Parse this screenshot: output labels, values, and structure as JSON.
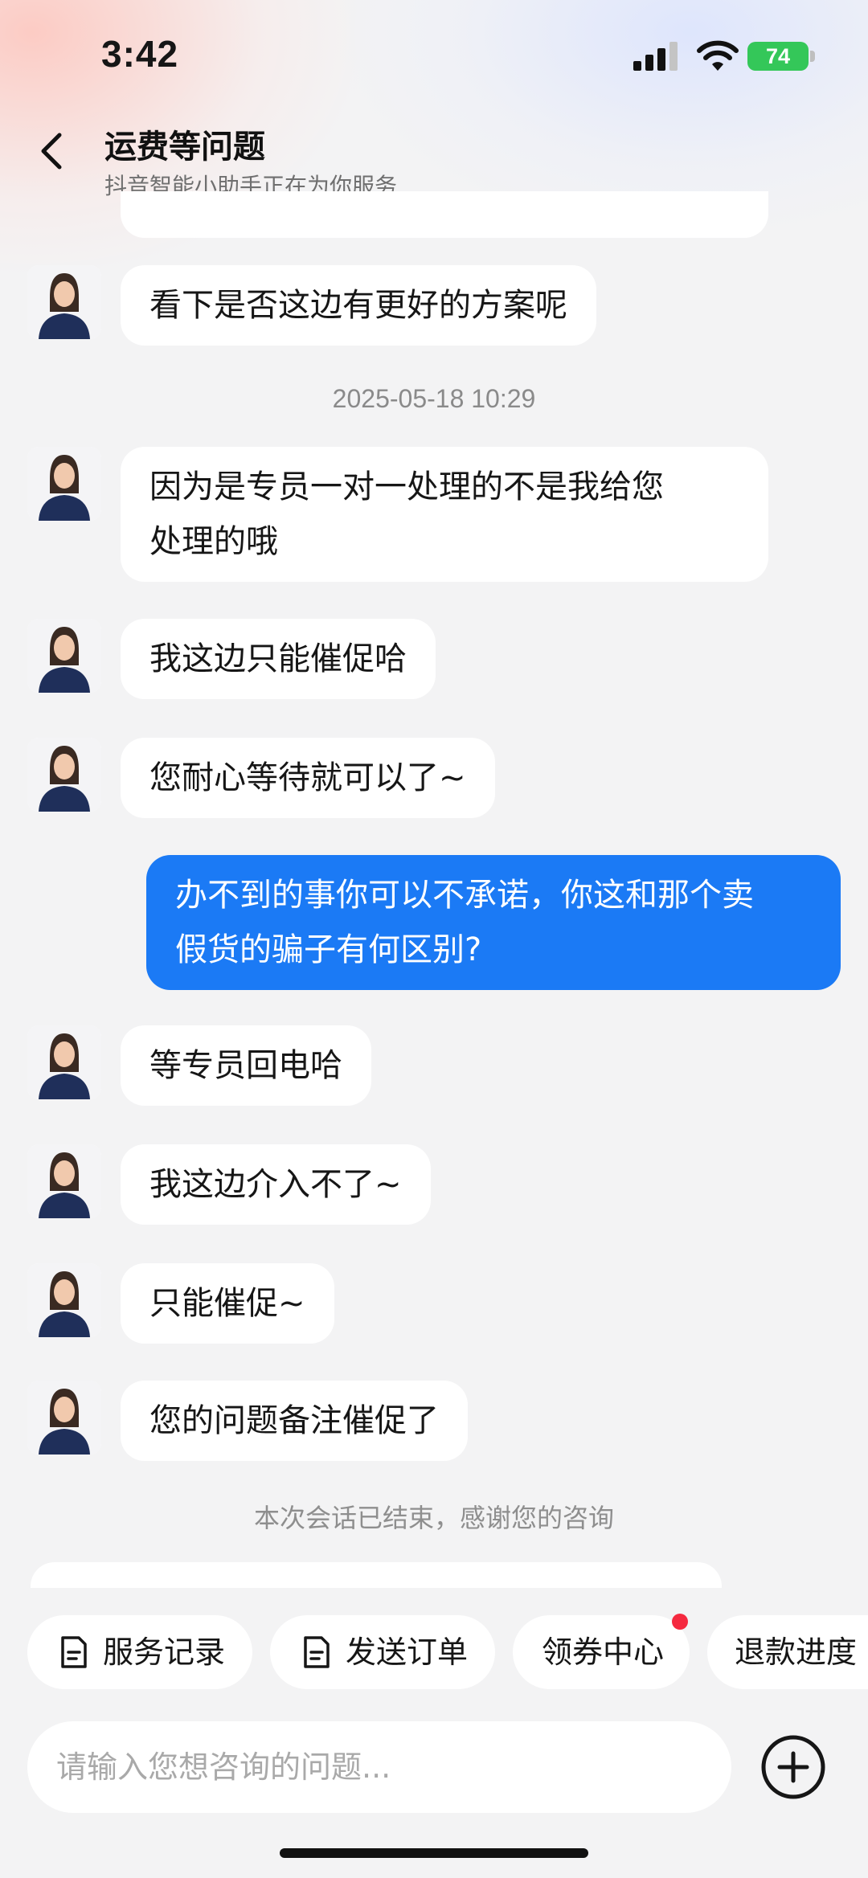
{
  "status_bar": {
    "time": "3:42",
    "battery": "74"
  },
  "header": {
    "title": "运费等问题",
    "subtitle": "抖音智能小助手正在为你服务"
  },
  "chat": {
    "messages": [
      {
        "from": "agent",
        "text": "看下是否这边有更好的方案呢"
      },
      {
        "from": "timestamp",
        "text": "2025-05-18 10:29"
      },
      {
        "from": "agent",
        "lines": [
          "因为是专员一对一处理的不是我给您",
          "处理的哦"
        ]
      },
      {
        "from": "agent",
        "text": "我这边只能催促哈"
      },
      {
        "from": "agent",
        "text": "您耐心等待就可以了~"
      },
      {
        "from": "user",
        "lines": [
          "办不到的事你可以不承诺，你这和那个卖",
          "假货的骗子有何区别?"
        ]
      },
      {
        "from": "agent",
        "text": "等专员回电哈"
      },
      {
        "from": "agent",
        "text": "我这边介入不了~"
      },
      {
        "from": "agent",
        "text": "只能催促~"
      },
      {
        "from": "agent",
        "text": "您的问题备注催促了"
      }
    ],
    "end_note": "本次会话已结束，感谢您的咨询"
  },
  "quick_actions": [
    {
      "label": "服务记录",
      "icon": "document-icon"
    },
    {
      "label": "发送订单",
      "icon": "document-icon"
    },
    {
      "label": "领券中心",
      "badge": true
    },
    {
      "label": "退款进度"
    }
  ],
  "composer": {
    "placeholder": "请输入您想咨询的问题..."
  },
  "colors": {
    "user_bubble": "#1b7af5",
    "agent_bubble": "#ffffff",
    "badge": "#f5293f",
    "battery": "#34c759"
  }
}
